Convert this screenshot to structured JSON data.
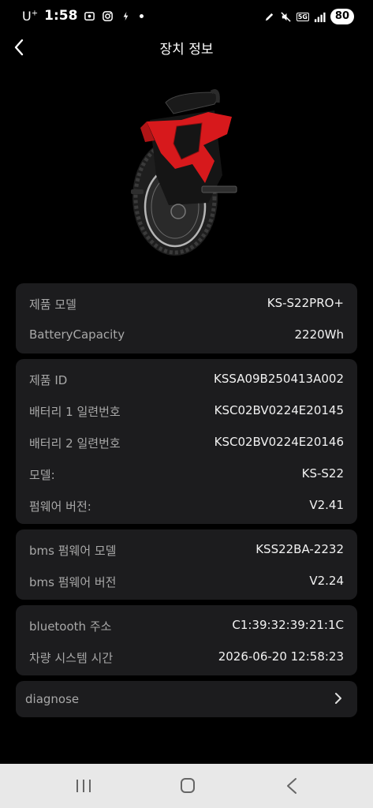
{
  "status_bar": {
    "carrier": "U",
    "carrier_sup": "+",
    "time": "1:58",
    "network": "5G",
    "battery": "80"
  },
  "header": {
    "title": "장치 정보"
  },
  "product": {
    "image_icon": "electric-unicycle-image"
  },
  "sections": [
    {
      "rows": [
        {
          "label": "제품 모델",
          "value": "KS-S22PRO+"
        },
        {
          "label": "BatteryCapacity",
          "value": "2220Wh"
        }
      ]
    },
    {
      "rows": [
        {
          "label": "제품 ID",
          "value": "KSSA09B250413A002"
        },
        {
          "label": "배터리 1 일련번호",
          "value": "KSC02BV0224E20145"
        },
        {
          "label": "배터리 2 일련번호",
          "value": "KSC02BV0224E20146"
        },
        {
          "label": "모델:",
          "value": "KS-S22"
        },
        {
          "label": "펌웨어 버전:",
          "value": "V2.41"
        }
      ]
    },
    {
      "rows": [
        {
          "label": "bms 펌웨어 모델",
          "value": "KSS22BA-2232"
        },
        {
          "label": "bms 펌웨어 버전",
          "value": "V2.24"
        }
      ]
    },
    {
      "rows": [
        {
          "label": "bluetooth 주소",
          "value": "C1:39:32:39:21:1C"
        },
        {
          "label": "차량 시스템 시간",
          "value": "2026-06-20 12:58:23"
        }
      ]
    }
  ],
  "diagnose": {
    "label": "diagnose"
  },
  "colors": {
    "background": "#000000",
    "card": "#1c1c1e",
    "label": "#a8a8a8",
    "value": "#f2f2f2",
    "accent_red": "#d7191c",
    "navbar": "#e8e8e8"
  }
}
